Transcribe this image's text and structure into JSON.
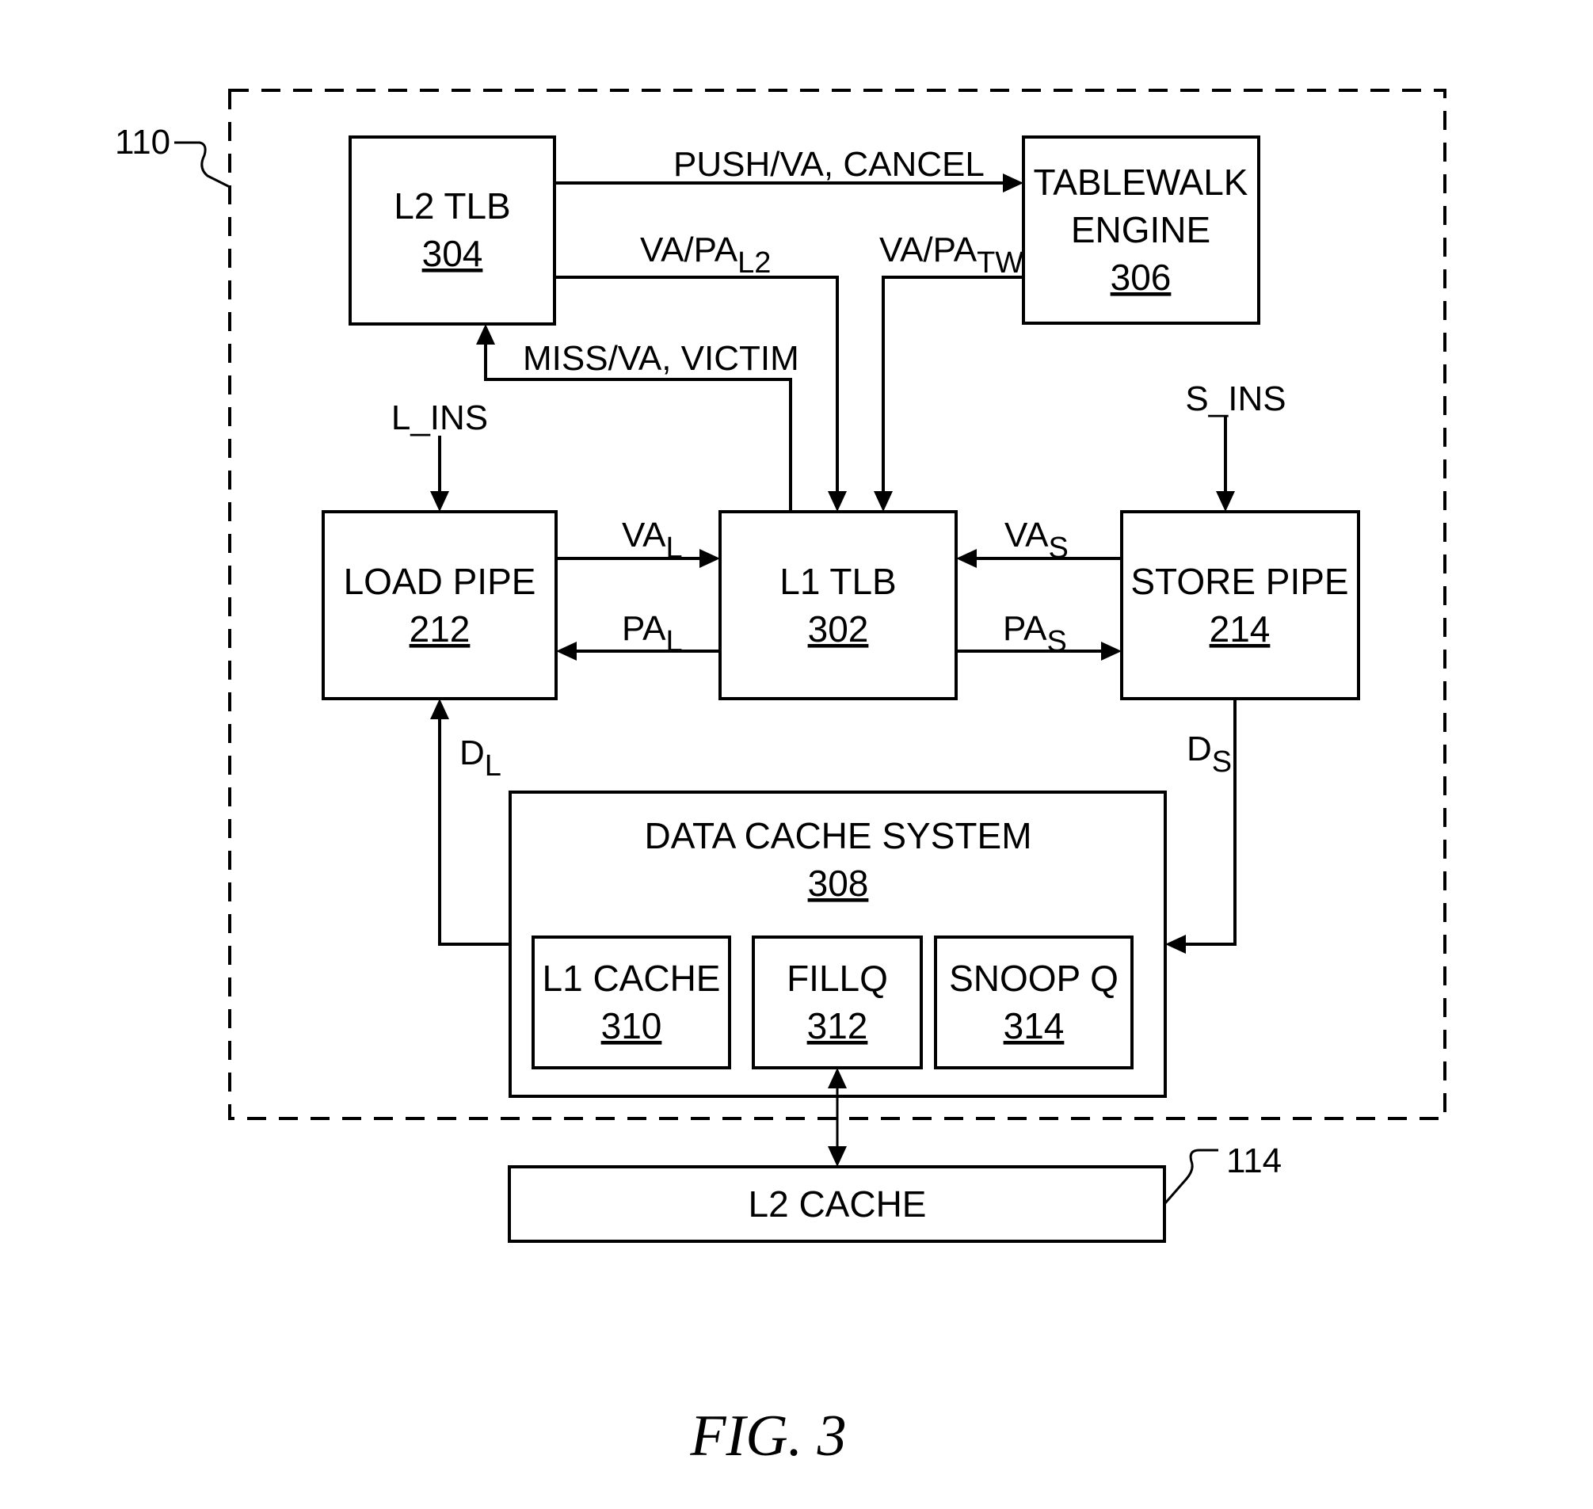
{
  "figure": {
    "caption": "FIG. 3",
    "container_ref": "110",
    "l2_cache_ref": "114"
  },
  "blocks": {
    "l2_tlb": {
      "name": "L2 TLB",
      "ref": "304"
    },
    "tablewalk": {
      "name_line1": "TABLEWALK",
      "name_line2": "ENGINE",
      "ref": "306"
    },
    "load_pipe": {
      "name": "LOAD PIPE",
      "ref": "212"
    },
    "l1_tlb": {
      "name": "L1 TLB",
      "ref": "302"
    },
    "store_pipe": {
      "name": "STORE PIPE",
      "ref": "214"
    },
    "data_cache": {
      "name": "DATA CACHE SYSTEM",
      "ref": "308"
    },
    "l1_cache": {
      "name": "L1 CACHE",
      "ref": "310"
    },
    "fillq": {
      "name": "FILLQ",
      "ref": "312"
    },
    "snoopq": {
      "name": "SNOOP Q",
      "ref": "314"
    },
    "l2_cache": {
      "name": "L2 CACHE"
    }
  },
  "signals": {
    "push": "PUSH/VA, CANCEL",
    "vapa_l2": {
      "base": "VA/PA",
      "sub": "L2"
    },
    "vapa_tw": {
      "base": "VA/PA",
      "sub": "TW"
    },
    "miss": "MISS/VA, VICTIM",
    "l_ins": "L_INS",
    "s_ins": "S_INS",
    "va_l": {
      "base": "VA",
      "sub": "L"
    },
    "pa_l": {
      "base": "PA",
      "sub": "L"
    },
    "va_s": {
      "base": "VA",
      "sub": "S"
    },
    "pa_s": {
      "base": "PA",
      "sub": "S"
    },
    "d_l": {
      "base": "D",
      "sub": "L"
    },
    "d_s": {
      "base": "D",
      "sub": "S"
    }
  }
}
